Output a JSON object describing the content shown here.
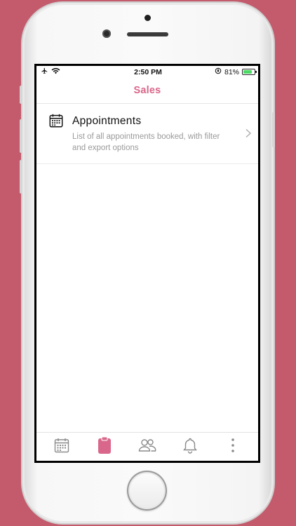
{
  "status_bar": {
    "time": "2:50 PM",
    "battery_percent": "81%",
    "battery_level": 0.81,
    "icons_left": [
      "airplane-icon",
      "wifi-icon"
    ],
    "icons_right": [
      "orientation-lock-icon",
      "battery-icon"
    ]
  },
  "nav": {
    "title": "Sales"
  },
  "list": {
    "items": [
      {
        "icon": "calendar-icon",
        "title": "Appointments",
        "description": "List of all appointments booked, with filter and export options"
      }
    ]
  },
  "tabbar": {
    "tabs": [
      {
        "icon": "calendar-icon",
        "active": false
      },
      {
        "icon": "clipboard-icon",
        "active": true
      },
      {
        "icon": "users-icon",
        "active": false
      },
      {
        "icon": "bell-icon",
        "active": false
      },
      {
        "icon": "more-vertical-icon",
        "active": false
      }
    ]
  },
  "colors": {
    "background": "#c35b6c",
    "accent": "#d9678b",
    "inactive_icon": "#8a8a8a"
  }
}
